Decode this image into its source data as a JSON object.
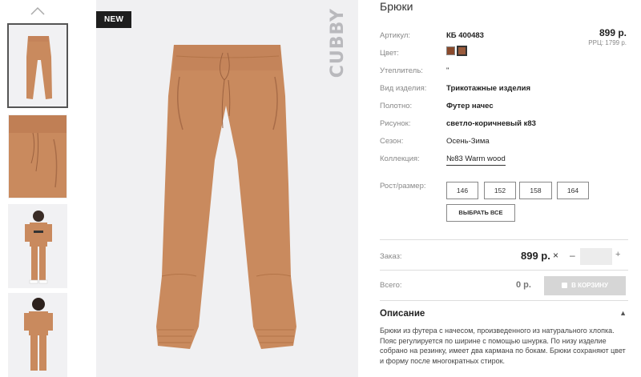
{
  "product": {
    "title": "Брюки",
    "badge": "NEW",
    "brand_watermark": "CUBBY",
    "price": "899 р.",
    "rrp": "РРЦ: 1799 р."
  },
  "attributes": [
    {
      "label": "Артикул:",
      "value": "КБ 400483"
    },
    {
      "label": "Цвет:",
      "value": ""
    },
    {
      "label": "Утеплитель:",
      "value": "\""
    },
    {
      "label": "Вид изделия:",
      "value": "Трикотажные изделия"
    },
    {
      "label": "Полотно:",
      "value": "Футер начес"
    },
    {
      "label": "Рисунок:",
      "value": "светло-коричневый к83"
    },
    {
      "label": "Сезон:",
      "value": "Осень-Зима"
    },
    {
      "label": "Коллекция:",
      "value": "№83 Warm wood"
    }
  ],
  "colors": [
    "#8a4a2c",
    "#9a5b3c"
  ],
  "sizes": {
    "label": "Рост/размер:",
    "options": [
      "146",
      "152",
      "158",
      "164"
    ],
    "select_all": "ВЫБРАТЬ ВСЕ"
  },
  "order": {
    "label": "Заказ:",
    "price": "899 р.",
    "times": "×",
    "minus": "–",
    "plus": "+",
    "quantity": ""
  },
  "total": {
    "label": "Всего:",
    "value": "0 р.",
    "cart_button": "В КОРЗИНУ"
  },
  "description": {
    "title": "Описание",
    "text": "Брюки из футера с начесом, произведенного из натурального хлопка. Пояс регулируется по ширине с помощью шнурка. По низу изделие собрано на резинку, имеет два кармана по бокам. Брюки сохраняют цвет и форму после многократных стирок."
  },
  "icons": {
    "thumb_up": "chevron-up-icon",
    "desc_caret": "caret-up-icon",
    "cart": "bag-icon"
  }
}
